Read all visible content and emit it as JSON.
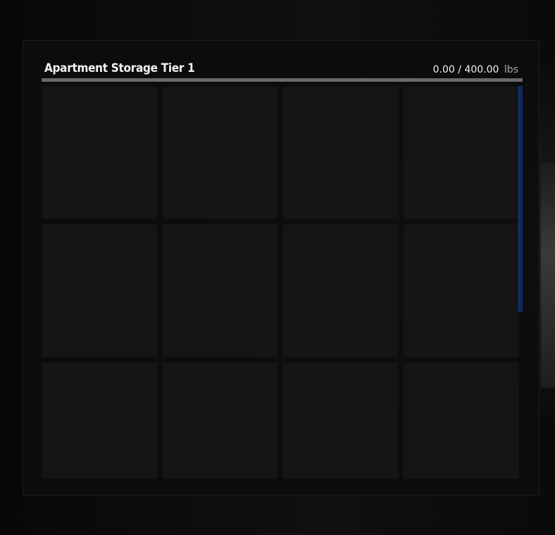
{
  "storage": {
    "title": "Apartment Storage Tier 1",
    "weight_current": "0.00",
    "weight_separator": "/",
    "weight_max": "400.00",
    "weight_unit": "lbs",
    "fill_fraction": 0
  },
  "colors": {
    "accent": "#2c5ec8",
    "scrollbar": "#0d2a5e",
    "slot": "#151515"
  },
  "slots": [
    {},
    {},
    {},
    {},
    {},
    {},
    {},
    {},
    {},
    {},
    {},
    {}
  ]
}
